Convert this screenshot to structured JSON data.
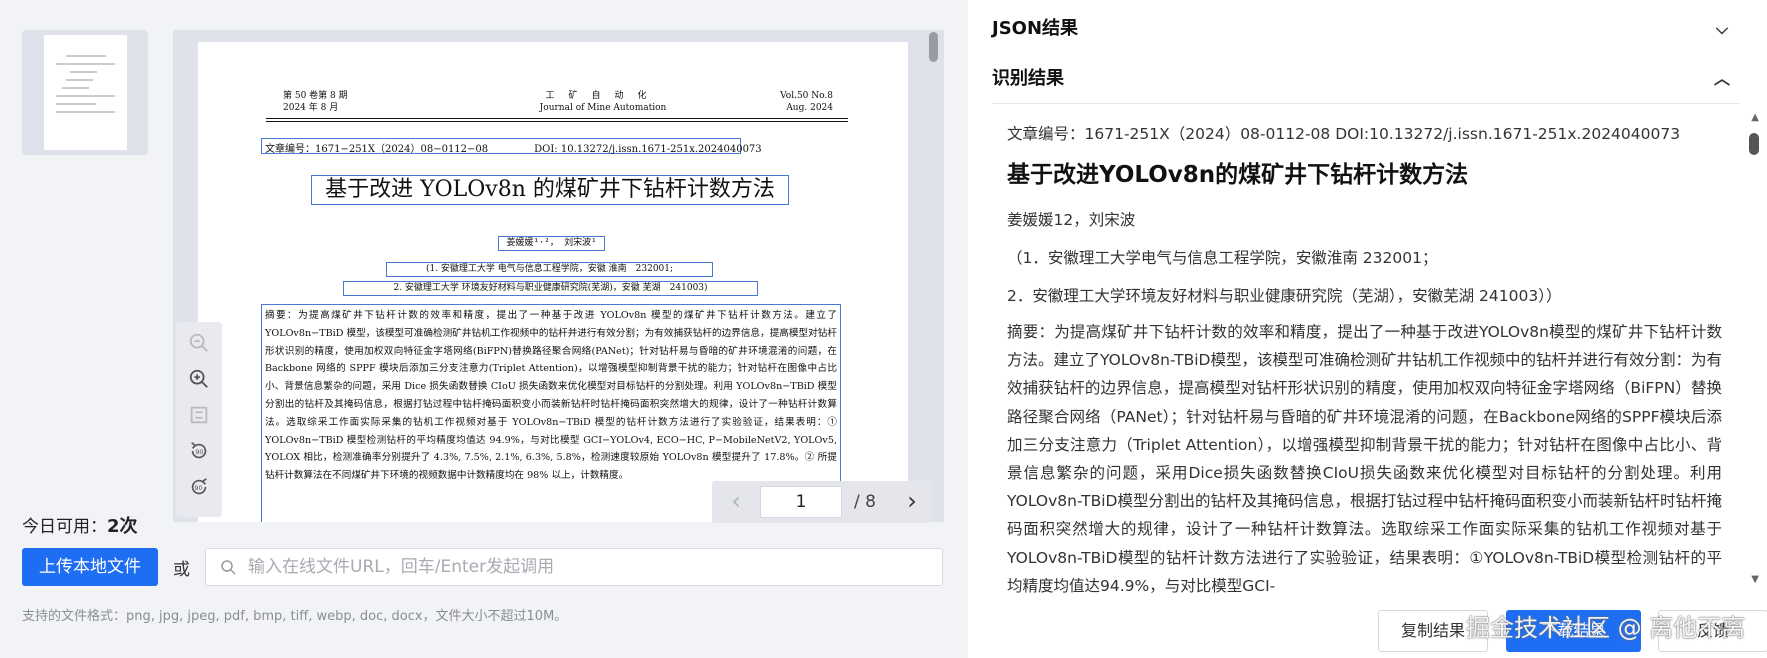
{
  "document": {
    "header_left_1": "第 50 卷第 8 期",
    "header_left_2": "2024 年 8 月",
    "header_center_1": "工矿自动化",
    "header_center_2": "Journal of Mine Automation",
    "header_right_1": "Vol.50 No.8",
    "header_right_2": "Aug. 2024",
    "article_no": "文章编号：1671−251X（2024）08−0112−08",
    "doi": "DOI: 10.13272/j.issn.1671-251x.2024040073",
    "title": "基于改进 YOLOv8n 的煤矿井下钻杆计数方法",
    "authors": "姜媛媛¹·²， 刘宋波¹",
    "affiliation_1": "(1. 安徽理工大学 电气与信息工程学院，安徽 淮南　232001;",
    "affiliation_2": "2. 安徽理工大学 环境友好材料与职业健康研究院(芜湖)，安徽 芜湖　241003)",
    "abstract": "摘要：为提高煤矿井下钻杆计数的效率和精度，提出了一种基于改进 YOLOv8n 模型的煤矿井下钻杆计数方法。建立了 YOLOv8n−TBiD 模型，该模型可准确检测矿井钻机工作视频中的钻杆并进行有效分割；为有效捕获钻杆的边界信息，提高模型对钻杆形状识别的精度，使用加权双向特征金字塔网络(BiFPN)替换路径聚合网络(PANet)；针对钻杆易与昏暗的矿井环境混淆的问题，在 Backbone 网络的 SPPF 模块后添加三分支注意力(Triplet Attention)，以增强模型抑制背景干扰的能力；针对钻杆在图像中占比小、背景信息繁杂的问题，采用 Dice 损失函数替换 CIoU 损失函数来优化模型对目标钻杆的分割处理。利用 YOLOv8n−TBiD 模型分割出的钻杆及其掩码信息，根据打钻过程中钻杆掩码面积变小而装新钻杆时钻杆掩码面积突然增大的规律，设计了一种钻杆计数算法。选取综采工作面实际采集的钻机工作视频对基于 YOLOv8n−TBiD 模型的钻杆计数方法进行了实验验证，结果表明：① YOLOv8n−TBiD 模型检测钻杆的平均精度均值达 94.9%，与对比模型 GCI−YOLOv4, ECO−HC, P−MobileNetV2, YOLOv5, YOLOX 相比，检测准确率分别提升了 4.3%, 7.5%, 2.1%, 6.3%, 5.8%，检测速度较原始 YOLOv8n 模型提升了 17.8%。② 所提钻杆计数算法在不同煤矿井下环境的视频数据中计数精度均在 98% 以上，计数精度。"
  },
  "pager": {
    "current": "1",
    "total": "/ 8"
  },
  "quota": {
    "label": "今日可用：",
    "value": "2次"
  },
  "upload": {
    "button": "上传本地文件",
    "or": "或",
    "url_placeholder": "输入在线文件URL，回车/Enter发起调用"
  },
  "formats": "支持的文件格式：png, jpg, jpeg, pdf, bmp, tiff, webp, doc, docx，文件大小不超过10M。",
  "sections": {
    "json": "JSON结果",
    "ocr": "识别结果"
  },
  "result": {
    "article_no": "文章编号：1671-251X（2024）08-0112-08 DOI:10.13272/j.issn.1671-251x.2024040073",
    "title": "基于改进YOLOv8n的煤矿井下钻杆计数方法",
    "authors": "姜媛媛12，刘宋波",
    "affiliation_1": "（1．安徽理工大学电气与信息工程学院，安徽淮南 232001；",
    "affiliation_2": "2．安徽理工大学环境友好材料与职业健康研究院（芜湖），安徽芜湖 241003））",
    "abstract": "摘要：为提高煤矿井下钻杆计数的效率和精度，提出了一种基于改进YOLOv8n模型的煤矿井下钻杆计数方法。建立了YOLOv8n-TBiD模型，该模型可准确检测矿井钻机工作视频中的钻杆并进行有效分割：为有效捕获钻杆的边界信息，提高模型对钻杆形状识别的精度，使用加权双向特征金字塔网络（BiFPN）替换路径聚合网络（PANet）；针对钻杆易与昏暗的矿井环境混淆的问题，在Backbone网络的SPPF模块后添加三分支注意力（Triplet Attention），以增强模型抑制背景干扰的能力；针对钻杆在图像中占比小、背景信息繁杂的问题，采用Dice损失函数替换CIoU损失函数来优化模型对目标钻杆的分割处理。利用YOLOv8n-TBiD模型分割出的钻杆及其掩码信息，根据打钻过程中钻杆掩码面积变小而装新钻杆时钻杆掩码面积突然增大的规律，设计了一种钻杆计数算法。选取综采工作面实际采集的钻机工作视频对基于YOLOv8n-TBiD模型的钻杆计数方法进行了实验验证，结果表明：①YOLOv8n-TBiD模型检测钻杆的平均精度均值达94.9%，与对比模型GCI-"
  },
  "actions": {
    "copy": "复制结果",
    "download": "下载结果",
    "feedback": "反馈"
  },
  "watermark": "掘金技术社区 @ 离他不离"
}
